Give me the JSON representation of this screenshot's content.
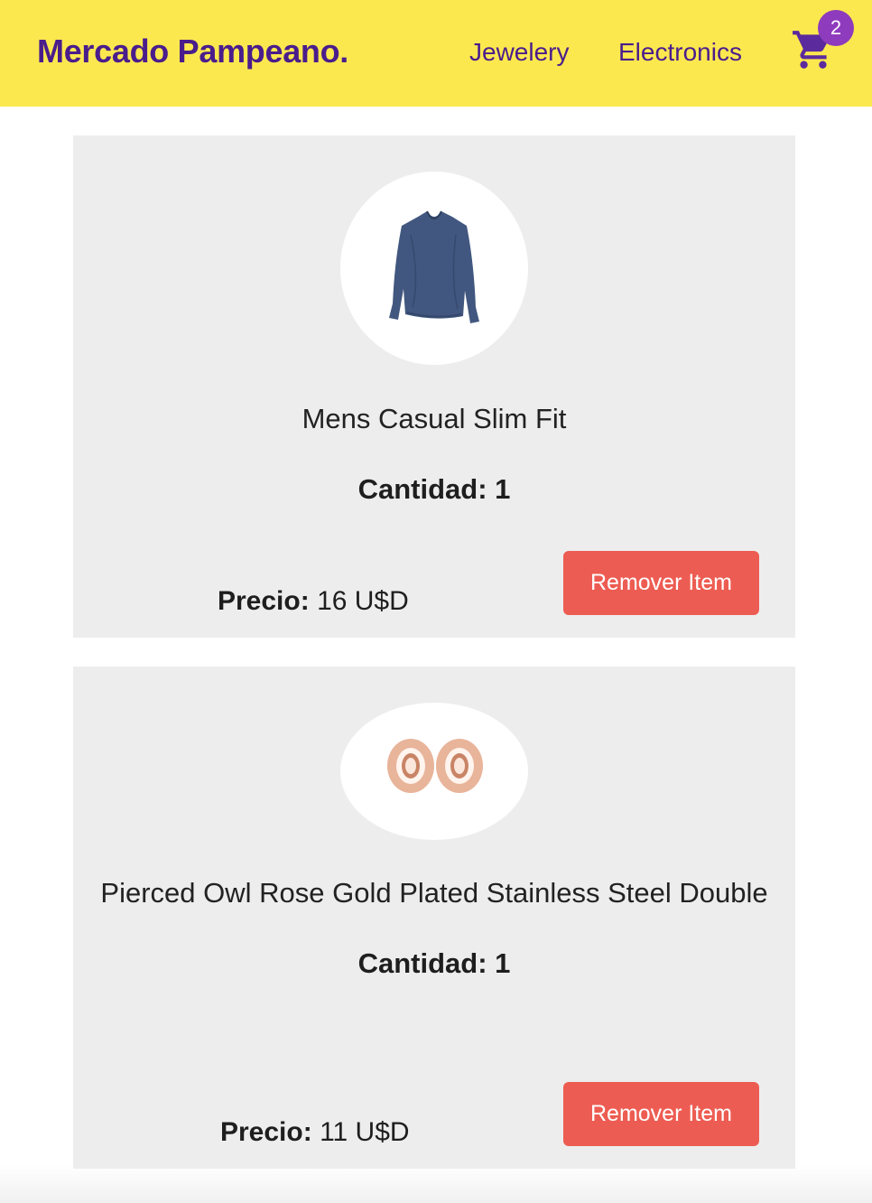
{
  "header": {
    "brand": "Mercado Pampeano.",
    "nav": [
      {
        "label": "Jewelery"
      },
      {
        "label": "Electronics"
      }
    ],
    "cart": {
      "icon": "cart-icon",
      "count": "2"
    },
    "colors": {
      "background": "#fbe84f",
      "text": "#4a1d8c",
      "badge": "#8e3bbd"
    }
  },
  "cart_items": [
    {
      "image": "shirt-image",
      "title": "Mens Casual Slim Fit",
      "quantity_label": "Cantidad: 1",
      "price_label": "Precio:",
      "price_value": "16 U$D",
      "remove_label": "Remover Item"
    },
    {
      "image": "earrings-image",
      "title": "Pierced Owl Rose Gold Plated Stainless Steel Double",
      "quantity_label": "Cantidad: 1",
      "price_label": "Precio:",
      "price_value": "11 U$D",
      "remove_label": "Remover Item"
    }
  ],
  "colors": {
    "card": "#ededed",
    "remove_button": "#ed5c52"
  }
}
